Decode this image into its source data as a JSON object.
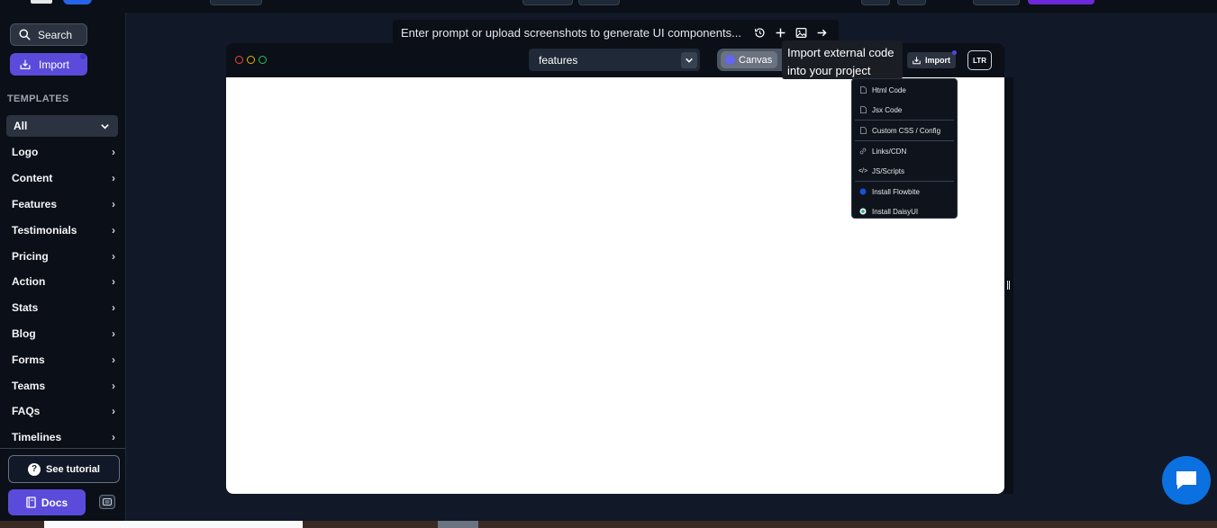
{
  "sidebar": {
    "search_label": "Search",
    "import_label": "Import",
    "templates_heading": "TEMPLATES",
    "filter_selected": "All",
    "categories": [
      {
        "label": "Logo"
      },
      {
        "label": "Content"
      },
      {
        "label": "Features"
      },
      {
        "label": "Testimonials"
      },
      {
        "label": "Pricing"
      },
      {
        "label": "Action"
      },
      {
        "label": "Stats"
      },
      {
        "label": "Blog"
      },
      {
        "label": "Forms"
      },
      {
        "label": "Teams"
      },
      {
        "label": "FAQs"
      },
      {
        "label": "Timelines"
      }
    ],
    "tutorial_label": "See tutorial",
    "docs_label": "Docs"
  },
  "prompt": {
    "placeholder": "Enter prompt or upload screenshots to generate UI components..."
  },
  "canvas_window": {
    "page_selected": "features",
    "canvas_label": "Canvas",
    "import_label": "Import",
    "direction_label": "LTR"
  },
  "tooltip": {
    "text": "Import external code into your project"
  },
  "import_menu": {
    "items": [
      {
        "label": "Html Code",
        "icon": "file-icon"
      },
      {
        "label": "Jsx Code",
        "icon": "react-file-icon"
      },
      {
        "label": "Custom CSS / Config",
        "icon": "css-file-icon"
      },
      {
        "label": "Links/CDN",
        "icon": "link-icon"
      },
      {
        "label": "JS/Scripts",
        "icon": "code-icon"
      },
      {
        "label": "Install Flowbite",
        "icon": "flowbite-icon"
      },
      {
        "label": "Install DaisyUI",
        "icon": "daisyui-icon"
      }
    ]
  },
  "colors": {
    "accent": "#5b4bdb",
    "chat_bubble": "#0b70e0",
    "background": "#111827"
  }
}
